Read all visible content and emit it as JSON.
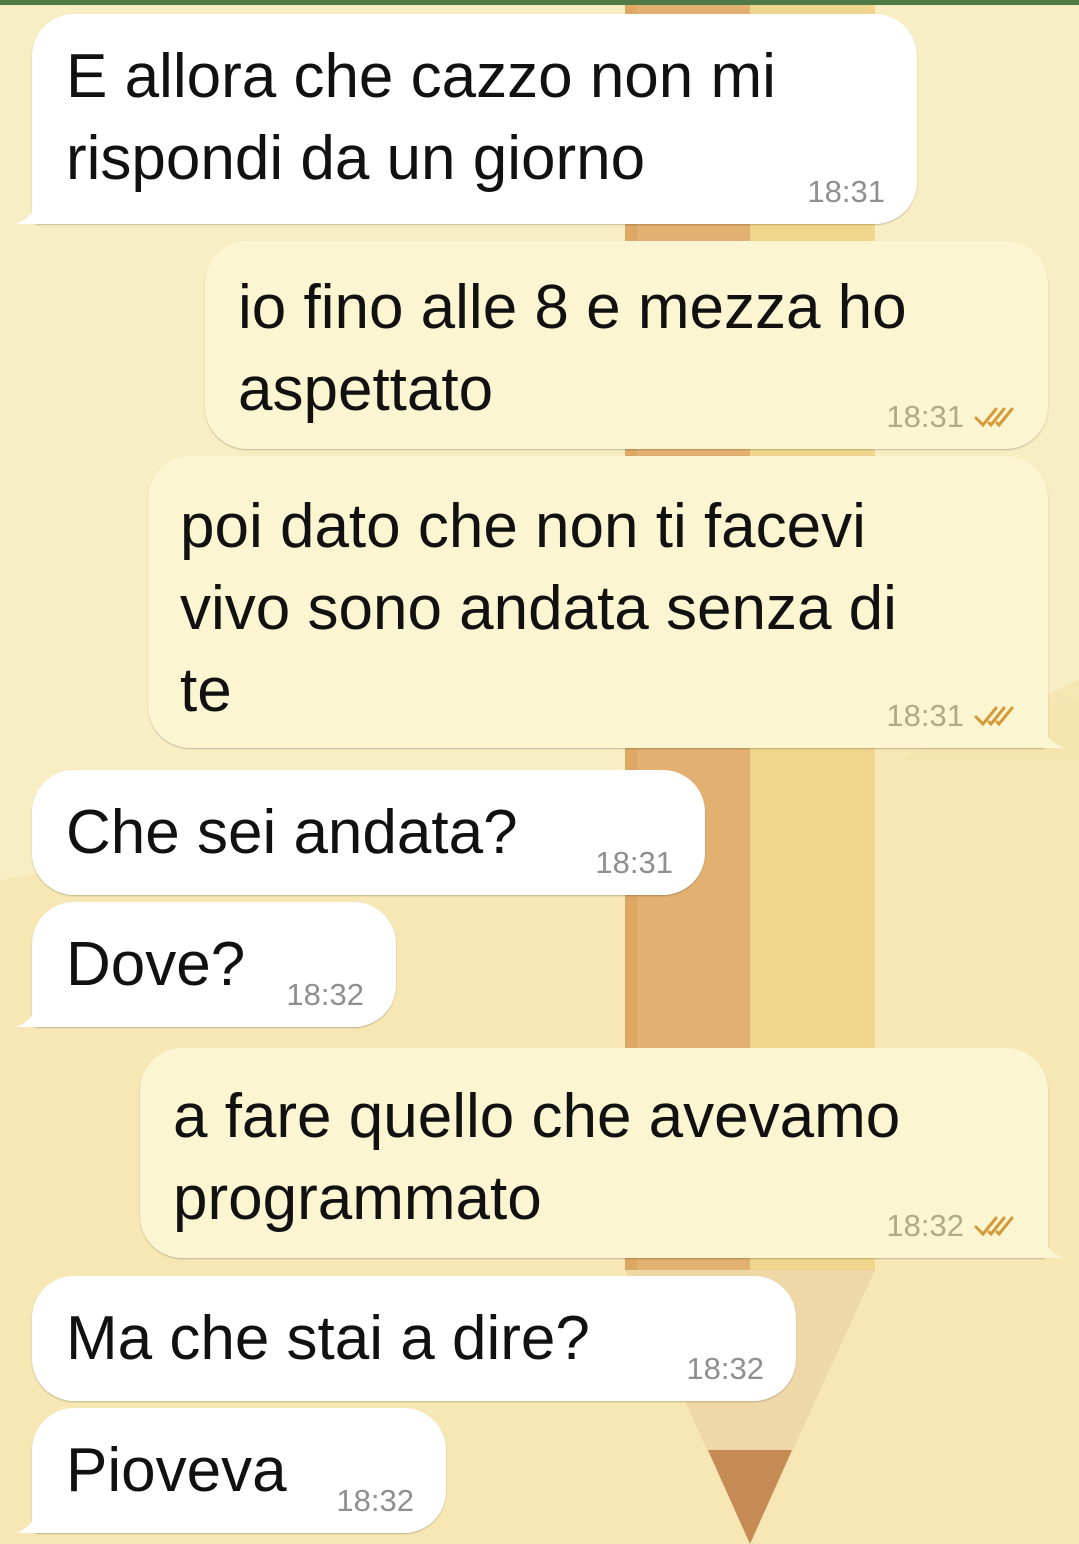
{
  "chat": {
    "messages": [
      {
        "direction": "in",
        "text": "E allora che cazzo non mi\nrispondi da un giorno",
        "time": "18:31",
        "read": false
      },
      {
        "direction": "out",
        "text": "io fino alle 8 e mezza ho\naspettato",
        "time": "18:31",
        "read": true
      },
      {
        "direction": "out",
        "text": "poi dato che non ti facevi\nvivo sono andata senza di\nte",
        "time": "18:31",
        "read": true
      },
      {
        "direction": "in",
        "text": "Che sei andata?",
        "time": "18:31",
        "read": false
      },
      {
        "direction": "in",
        "text": "Dove?",
        "time": "18:32",
        "read": false
      },
      {
        "direction": "out",
        "text": "a fare quello che avevamo\nprogrammato",
        "time": "18:32",
        "read": true
      },
      {
        "direction": "in",
        "text": "Ma che stai a dire?",
        "time": "18:32",
        "read": false
      },
      {
        "direction": "in",
        "text": "Pioveva",
        "time": "18:32",
        "read": false
      }
    ]
  },
  "icons": {
    "read_receipt": "double-check-icon"
  },
  "colors": {
    "incoming_bubble": "#ffffff",
    "outgoing_bubble": "#fbf5d2",
    "wallpaper": "#f8eec4",
    "read_ticks": "#d49a3a",
    "timestamp": "#8f8f8f"
  }
}
